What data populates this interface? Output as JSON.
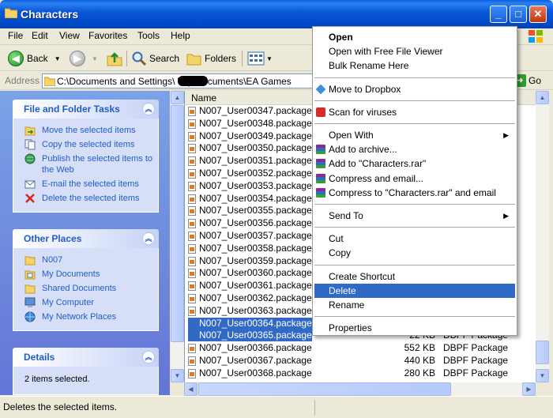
{
  "window": {
    "title": "Characters"
  },
  "menubar": {
    "items": [
      "File",
      "Edit",
      "View",
      "Favorites",
      "Tools",
      "Help"
    ]
  },
  "toolbar": {
    "back": "Back",
    "search": "Search",
    "folders": "Folders"
  },
  "address": {
    "label": "Address",
    "path": "C:\\Documents and Settings\\          \\My Documents\\EA Games",
    "go": "Go"
  },
  "tasks": {
    "file_folder": {
      "title": "File and Folder Tasks",
      "items": [
        "Move the selected items",
        "Copy the selected items",
        "Publish the selected items to the Web",
        "E-mail the selected items",
        "Delete the selected items"
      ]
    },
    "other_places": {
      "title": "Other Places",
      "items": [
        "N007",
        "My Documents",
        "Shared Documents",
        "My Computer",
        "My Network Places"
      ]
    },
    "details": {
      "title": "Details",
      "text": "2 items selected."
    }
  },
  "filelist": {
    "column_name": "Name",
    "rows": [
      {
        "name": "N007_User00347.package",
        "size": "",
        "type": "",
        "selected": false
      },
      {
        "name": "N007_User00348.package",
        "size": "",
        "type": "",
        "selected": false
      },
      {
        "name": "N007_User00349.package",
        "size": "",
        "type": "",
        "selected": false
      },
      {
        "name": "N007_User00350.package",
        "size": "",
        "type": "",
        "selected": false
      },
      {
        "name": "N007_User00351.package",
        "size": "",
        "type": "",
        "selected": false
      },
      {
        "name": "N007_User00352.package",
        "size": "",
        "type": "",
        "selected": false
      },
      {
        "name": "N007_User00353.package",
        "size": "",
        "type": "",
        "selected": false
      },
      {
        "name": "N007_User00354.package",
        "size": "",
        "type": "",
        "selected": false
      },
      {
        "name": "N007_User00355.package",
        "size": "",
        "type": "",
        "selected": false
      },
      {
        "name": "N007_User00356.package",
        "size": "",
        "type": "",
        "selected": false
      },
      {
        "name": "N007_User00357.package",
        "size": "",
        "type": "",
        "selected": false
      },
      {
        "name": "N007_User00358.package",
        "size": "",
        "type": "",
        "selected": false
      },
      {
        "name": "N007_User00359.package",
        "size": "",
        "type": "",
        "selected": false
      },
      {
        "name": "N007_User00360.package",
        "size": "",
        "type": "",
        "selected": false
      },
      {
        "name": "N007_User00361.package",
        "size": "",
        "type": "",
        "selected": false
      },
      {
        "name": "N007_User00362.package",
        "size": "",
        "type": "",
        "selected": false
      },
      {
        "name": "N007_User00363.package",
        "size": "",
        "type": "",
        "selected": false
      },
      {
        "name": "N007_User00364.package",
        "size": "",
        "type": "",
        "selected": true
      },
      {
        "name": "N007_User00365.package",
        "size": "22 KB",
        "type": "DBPF Package",
        "selected": true
      },
      {
        "name": "N007_User00366.package",
        "size": "552 KB",
        "type": "DBPF Package",
        "selected": false
      },
      {
        "name": "N007_User00367.package",
        "size": "440 KB",
        "type": "DBPF Package",
        "selected": false
      },
      {
        "name": "N007_User00368.package",
        "size": "280 KB",
        "type": "DBPF Package",
        "selected": false
      }
    ]
  },
  "context_menu": {
    "items": [
      {
        "label": "Open",
        "bold": true,
        "icon": ""
      },
      {
        "label": "Open with Free File Viewer",
        "icon": ""
      },
      {
        "label": "Bulk Rename Here",
        "icon": ""
      },
      {
        "sep": true
      },
      {
        "label": "Move to Dropbox",
        "icon": "dropbox-icon"
      },
      {
        "sep": true
      },
      {
        "label": "Scan for viruses",
        "icon": "antivirus-icon"
      },
      {
        "sep": true
      },
      {
        "label": "Open With",
        "submenu": true,
        "icon": ""
      },
      {
        "label": "Add to archive...",
        "icon": "winrar-icon"
      },
      {
        "label": "Add to \"Characters.rar\"",
        "icon": "winrar-icon"
      },
      {
        "label": "Compress and email...",
        "icon": "winrar-icon"
      },
      {
        "label": "Compress to \"Characters.rar\" and email",
        "icon": "winrar-icon"
      },
      {
        "sep": true
      },
      {
        "label": "Send To",
        "submenu": true,
        "icon": ""
      },
      {
        "sep": true
      },
      {
        "label": "Cut",
        "icon": ""
      },
      {
        "label": "Copy",
        "icon": ""
      },
      {
        "sep": true
      },
      {
        "label": "Create Shortcut",
        "icon": ""
      },
      {
        "label": "Delete",
        "highlighted": true,
        "icon": ""
      },
      {
        "label": "Rename",
        "icon": ""
      },
      {
        "sep": true
      },
      {
        "label": "Properties",
        "icon": ""
      }
    ]
  },
  "statusbar": {
    "text": "Deletes the selected items."
  },
  "colors": {
    "selection": "#316ac5",
    "title_blue": "#0a58d8",
    "task_link": "#215dc6"
  }
}
